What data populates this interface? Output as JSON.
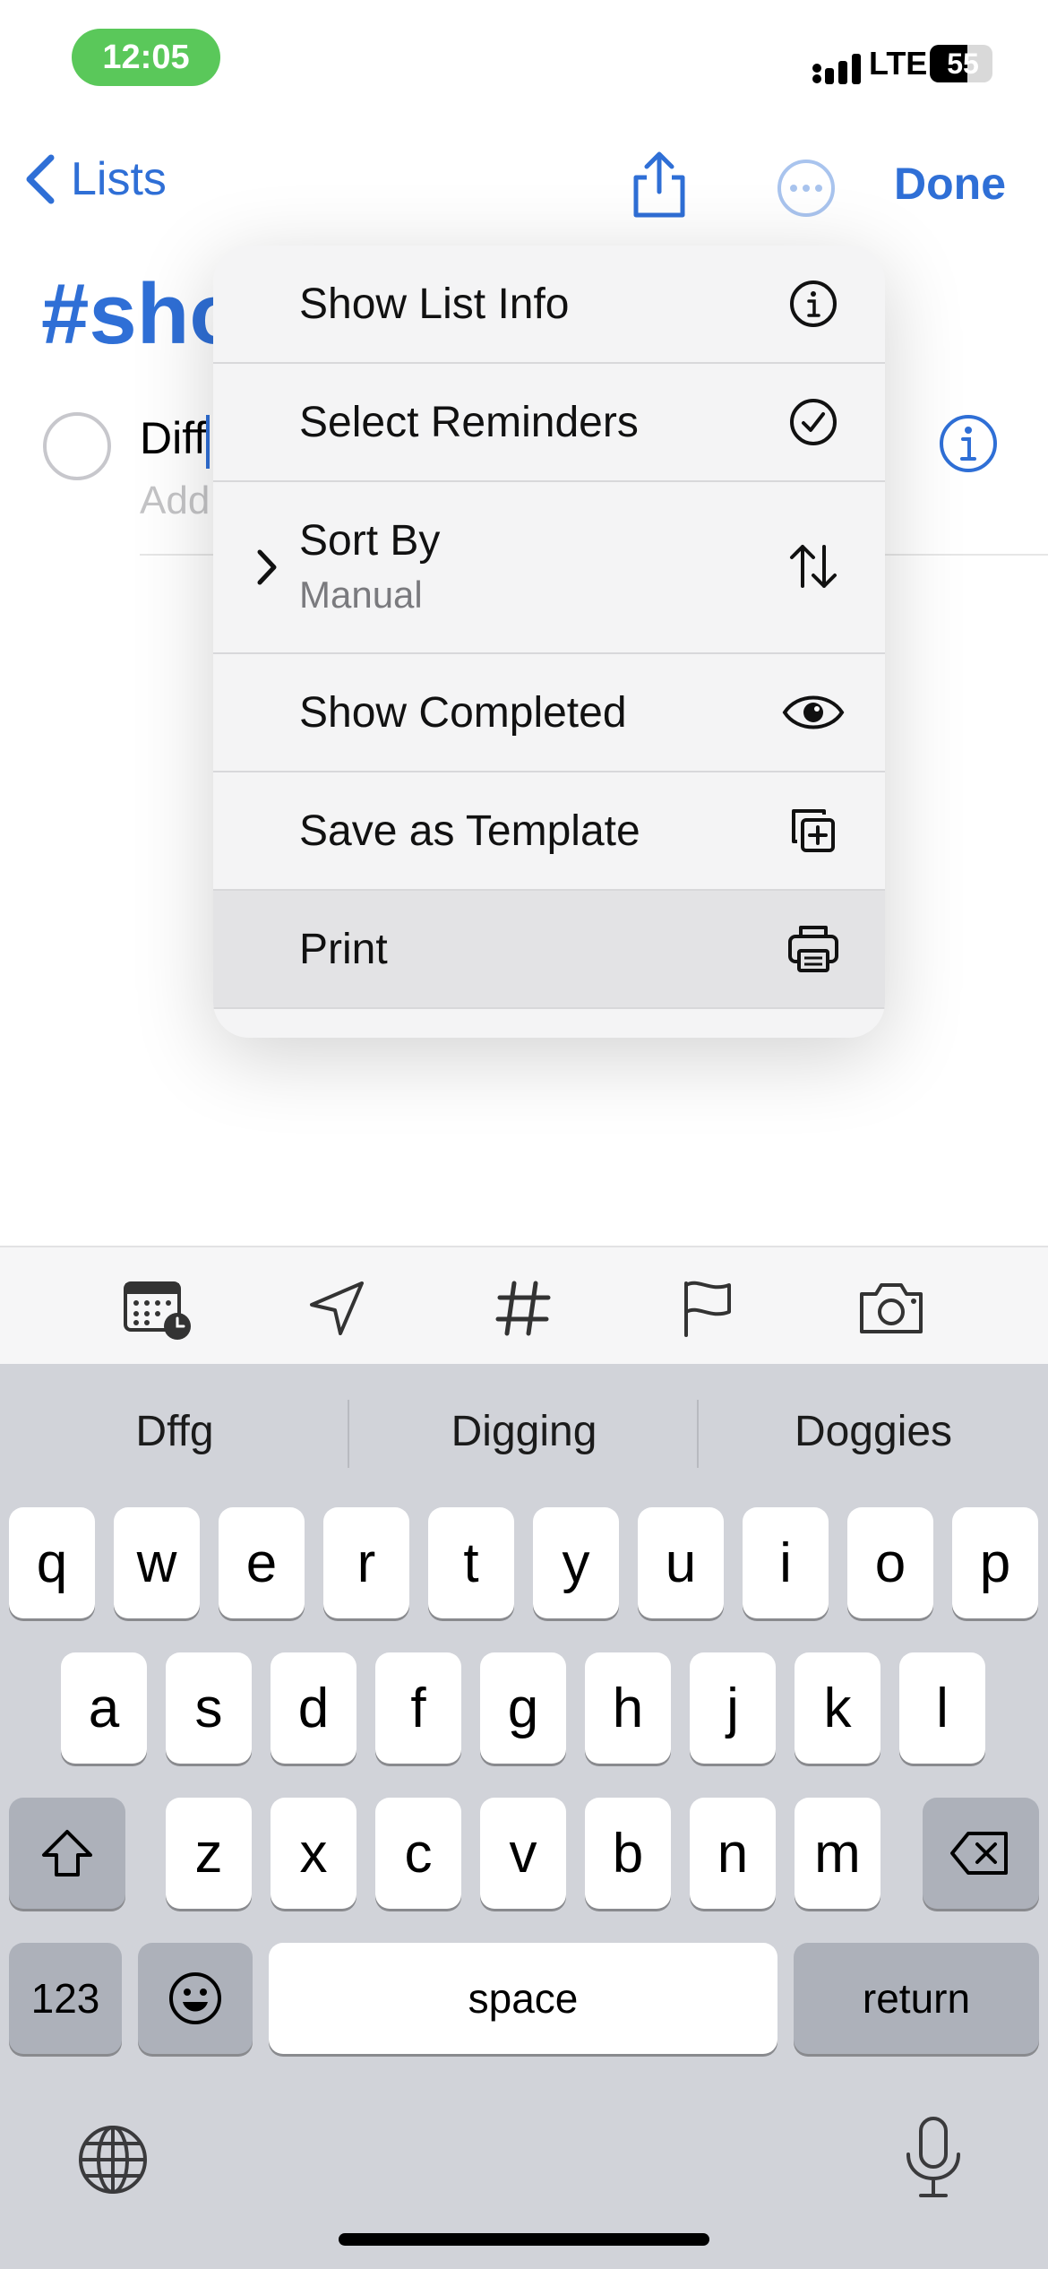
{
  "status_bar": {
    "time": "12:05",
    "network": "LTE",
    "battery": "55"
  },
  "nav": {
    "back_label": "Lists",
    "done_label": "Done"
  },
  "list": {
    "title_visible": "#sho",
    "item_text": "Diff",
    "item_notes_placeholder": "Add"
  },
  "menu": {
    "items": [
      {
        "label": "Show List Info",
        "icon": "info-circle-icon"
      },
      {
        "label": "Select Reminders",
        "icon": "checkmark-circle-icon"
      },
      {
        "label": "Sort By",
        "sublabel": "Manual",
        "icon": "sort-arrows-icon",
        "has_submenu": true
      },
      {
        "label": "Show Completed",
        "icon": "eye-icon"
      },
      {
        "label": "Save as Template",
        "icon": "duplicate-plus-icon"
      },
      {
        "label": "Print",
        "icon": "printer-icon",
        "highlighted": true
      }
    ]
  },
  "toolbar": {
    "items": [
      "calendar-clock-icon",
      "location-arrow-icon",
      "hashtag-icon",
      "flag-icon",
      "camera-icon"
    ]
  },
  "keyboard": {
    "suggestions": [
      "Dffg",
      "Digging",
      "Doggies"
    ],
    "row1": [
      "q",
      "w",
      "e",
      "r",
      "t",
      "y",
      "u",
      "i",
      "o",
      "p"
    ],
    "row2": [
      "a",
      "s",
      "d",
      "f",
      "g",
      "h",
      "j",
      "k",
      "l"
    ],
    "row3": [
      "z",
      "x",
      "c",
      "v",
      "b",
      "n",
      "m"
    ],
    "numbers_label": "123",
    "space_label": "space",
    "return_label": "return"
  },
  "colors": {
    "accent": "#2f6fd6",
    "status_pill": "#5ac85a"
  }
}
